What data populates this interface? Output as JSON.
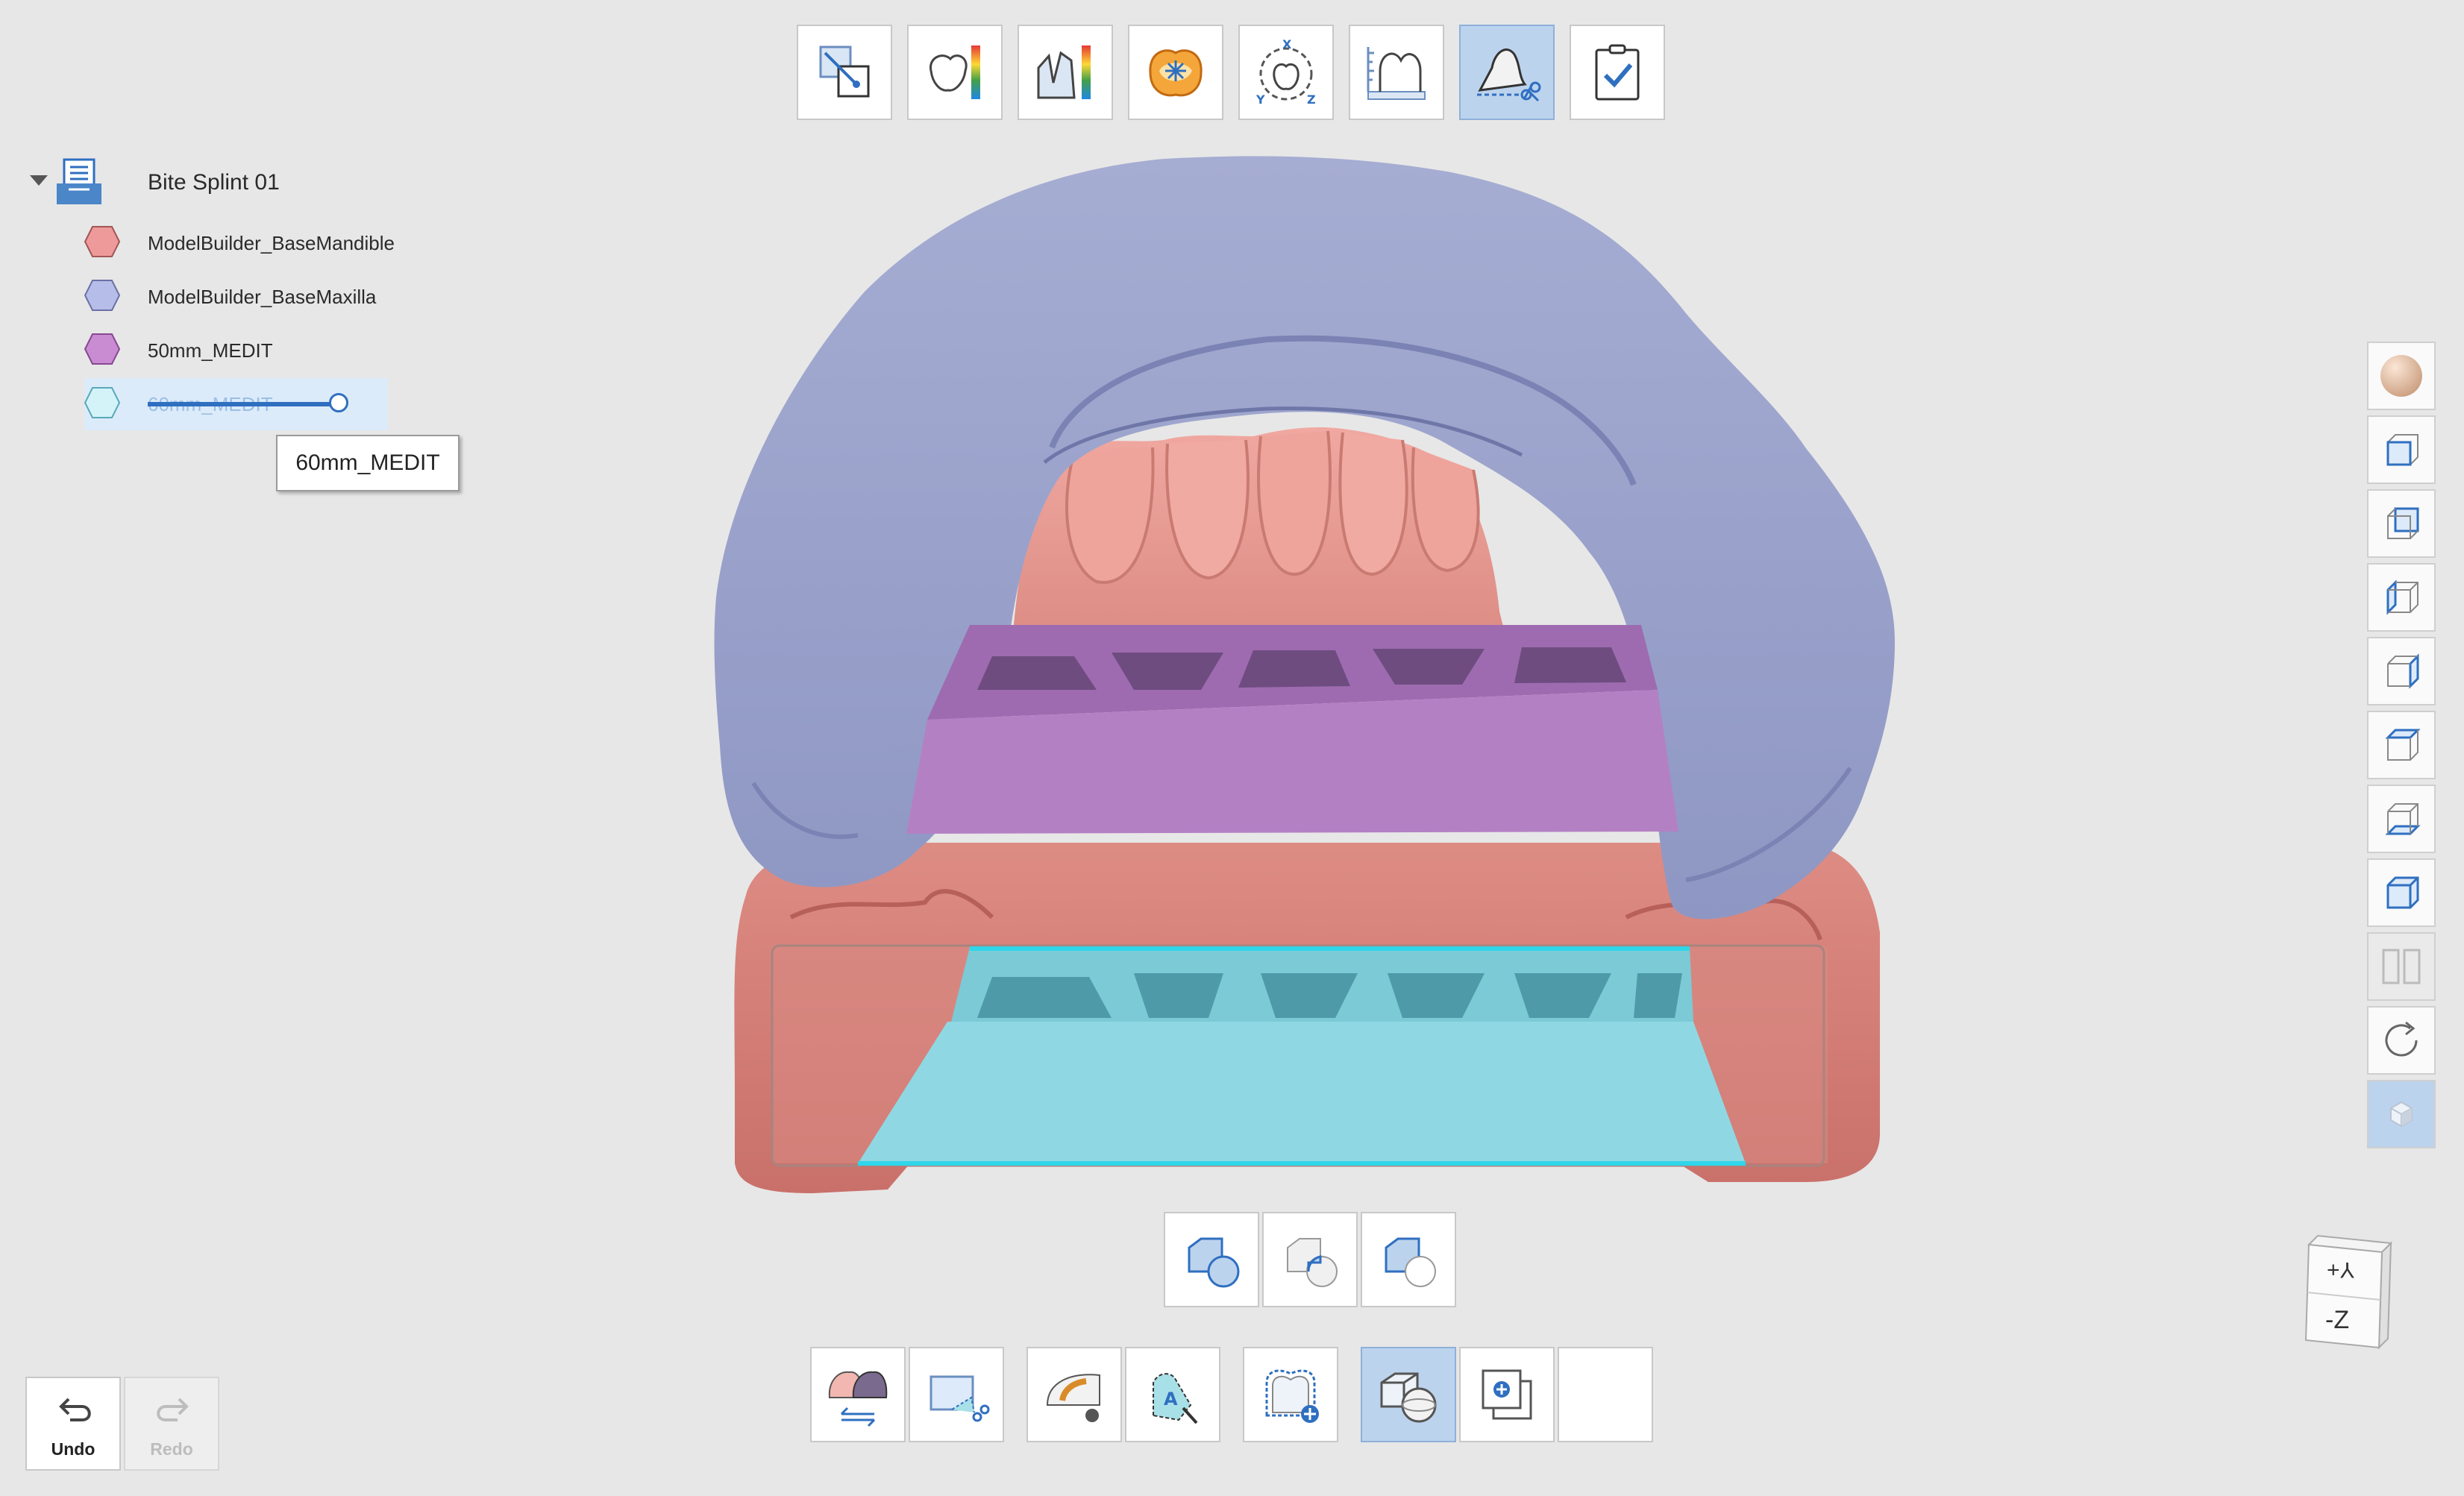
{
  "project": {
    "title": "Bite Splint 01",
    "items": [
      {
        "label": "ModelBuilder_BaseMandible",
        "color": "#ef9a9a"
      },
      {
        "label": "ModelBuilder_BaseMaxilla",
        "color": "#b6bde8"
      },
      {
        "label": "50mm_MEDIT",
        "color": "#c98bd1"
      },
      {
        "label": "60mm_MEDIT",
        "color": "#d4f3f8",
        "slider_opacity": 0.9
      }
    ]
  },
  "tooltip": "60mm_MEDIT",
  "top_toolbar": [
    "transform-tool",
    "deviation-map-tool",
    "thickness-map-tool",
    "occlusion-map-tool",
    "align-axis-tool",
    "measure-tool",
    "trim-tool",
    "check-tool"
  ],
  "view_panel": [
    "texture-ball",
    "view-front",
    "view-back",
    "view-left",
    "view-right",
    "view-top",
    "view-bottom",
    "view-iso",
    "view-split",
    "view-rotate",
    "view-solid"
  ],
  "orientation_cube": {
    "top": "Y+",
    "front": "-Z"
  },
  "undo": {
    "label": "Undo"
  },
  "redo": {
    "label": "Redo"
  },
  "colors": {
    "maxilla": "#9ba3c9",
    "mandible": "#d77f77",
    "block50": "#b57fc4",
    "block60": "#8fd8e3",
    "accent": "#2f6fc0"
  }
}
